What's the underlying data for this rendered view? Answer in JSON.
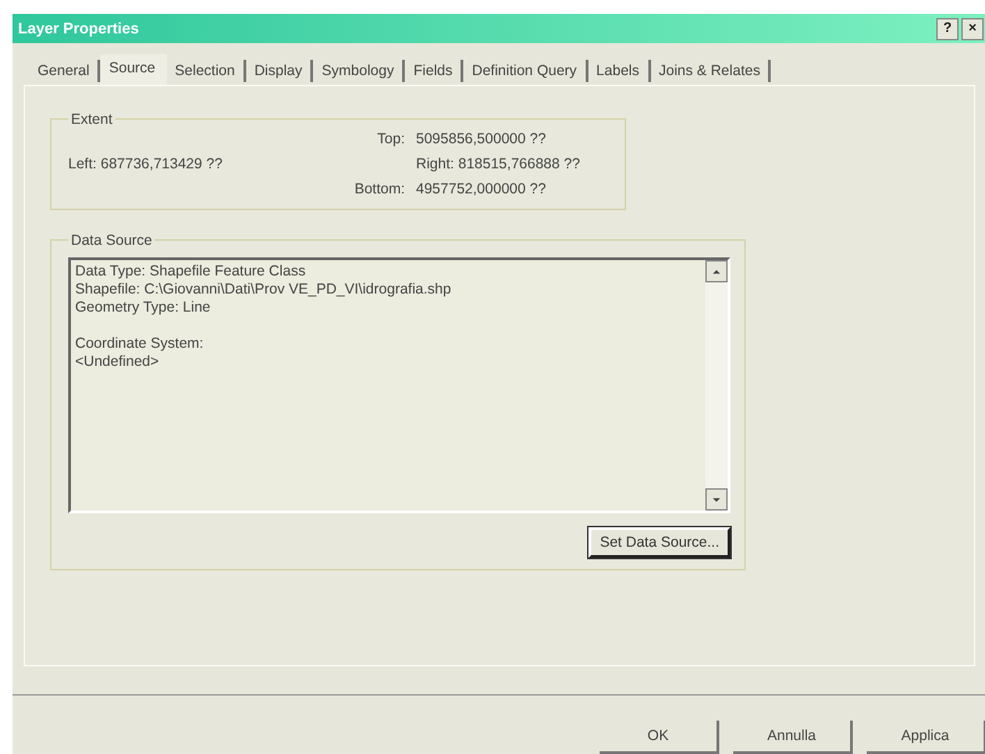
{
  "window": {
    "title": "Layer Properties",
    "title_buttons": [
      "?",
      "×"
    ]
  },
  "tabs": [
    {
      "label": "General",
      "selected": false
    },
    {
      "label": "Source",
      "selected": true
    },
    {
      "label": "Selection",
      "selected": false
    },
    {
      "label": "Display",
      "selected": false
    },
    {
      "label": "Symbology",
      "selected": false
    },
    {
      "label": "Fields",
      "selected": false
    },
    {
      "label": "Definition Query",
      "selected": false
    },
    {
      "label": "Labels",
      "selected": false
    },
    {
      "label": "Joins & Relates",
      "selected": false
    }
  ],
  "extent": {
    "title": "Extent",
    "top_label": "Top:",
    "top": "5095856,500000 ??",
    "left_label": "Left:",
    "left": "687736,713429 ??",
    "right_label": "Right:",
    "right": "818515,766888 ??",
    "bottom_label": "Bottom:",
    "bottom": "4957752,000000 ??"
  },
  "data_source": {
    "title": "Data Source",
    "paragraphs": [
      [
        "Data Type: Shapefile Feature Class",
        "Shapefile: C:\\Giovanni\\Dati\\Prov VE_PD_VI\\idrografia.shp",
        "Geometry Type: Line"
      ],
      [
        "Coordinate System:",
        "<Undefined>"
      ]
    ],
    "button": "Set Data Source..."
  },
  "buttons": [
    "OK",
    "Annulla",
    "Applica"
  ]
}
